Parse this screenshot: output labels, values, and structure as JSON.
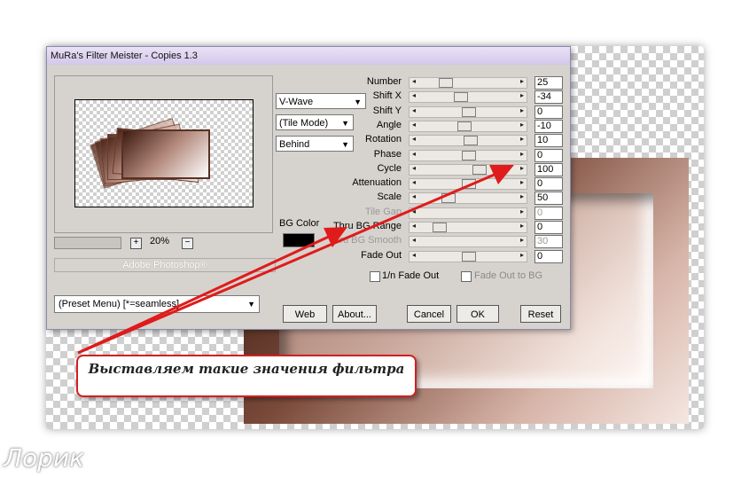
{
  "window_title": "MuRa's Filter Meister - Copies 1.3",
  "zoom": "20%",
  "zoom_plus": "+",
  "zoom_minus": "−",
  "adobe_bar": "Adobe Photoshop®",
  "preset_menu": "(Preset Menu)  [*=seamless]",
  "dropdowns": {
    "mode": "V-Wave",
    "tile": "(Tile Mode)",
    "order": "Behind"
  },
  "bg_color_label": "BG Color",
  "params": [
    {
      "label": "Number",
      "value": "25",
      "disabled": false,
      "level": 0.22
    },
    {
      "label": "Shift X",
      "value": "-34",
      "disabled": false,
      "level": 0.4
    },
    {
      "label": "Shift Y",
      "value": "0",
      "disabled": false,
      "level": 0.5
    },
    {
      "label": "Angle",
      "value": "-10",
      "disabled": false,
      "level": 0.45
    },
    {
      "label": "Rotation",
      "value": "10",
      "disabled": false,
      "level": 0.52
    },
    {
      "label": "Phase",
      "value": "0",
      "disabled": false,
      "level": 0.5
    },
    {
      "label": "Cycle",
      "value": "100",
      "disabled": false,
      "level": 0.63
    },
    {
      "label": "Attenuation",
      "value": "0",
      "disabled": false,
      "level": 0.5
    },
    {
      "label": "Scale",
      "value": "50",
      "disabled": false,
      "level": 0.25
    },
    {
      "label": "Tile Gap",
      "value": "0",
      "disabled": true,
      "level": 0.0
    },
    {
      "label": "Thru BG Range",
      "value": "0",
      "disabled": false,
      "level": 0.15
    },
    {
      "label": "Thru BG Smooth",
      "value": "30",
      "disabled": true,
      "level": 0.0
    },
    {
      "label": "Fade Out",
      "value": "0",
      "disabled": false,
      "level": 0.5
    }
  ],
  "checkboxes": {
    "fade_1n": "1/n Fade Out",
    "fade_bg": "Fade Out to BG"
  },
  "buttons": {
    "web": "Web",
    "about": "About...",
    "cancel": "Cancel",
    "ok": "OK",
    "reset": "Reset"
  },
  "note_text": "Выставляем такие значения фильтра",
  "watermark": "Лорик",
  "colors": {
    "accent_red": "#d21f1f",
    "dialog_bg": "#d6d3ce"
  }
}
